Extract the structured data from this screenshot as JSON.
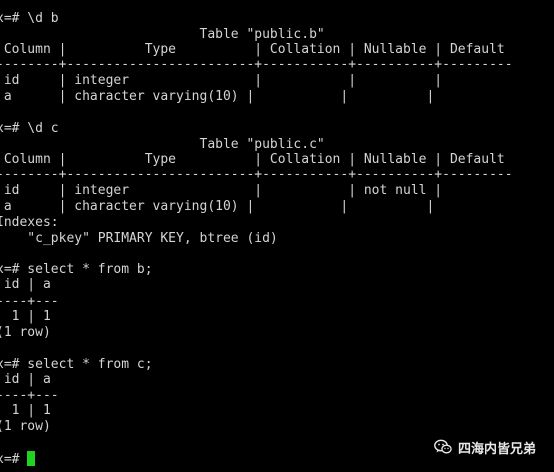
{
  "terminal": {
    "lines": [
      "x=# \\d b",
      "                          Table \"public.b\"",
      " Column |          Type          | Collation | Nullable | Default",
      "--------+------------------------+-----------+----------+---------",
      " id     | integer                |           |          |",
      " a      | character varying(10) |           |          |",
      "",
      "x=# \\d c",
      "                          Table \"public.c\"",
      " Column |          Type          | Collation | Nullable | Default",
      "--------+------------------------+-----------+----------+---------",
      " id     | integer                |           | not null |",
      " a      | character varying(10) |           |          |",
      "Indexes:",
      "    \"c_pkey\" PRIMARY KEY, btree (id)",
      "",
      "x=# select * from b;",
      " id | a",
      "----+---",
      "  1 | 1",
      "(1 row)",
      "",
      "x=# select * from c;",
      " id | a",
      "----+---",
      "  1 | 1",
      "(1 row)",
      "",
      "x=# "
    ],
    "cursor_color": "#21d321",
    "text_color": "#d4d4d4",
    "background": "#000000"
  },
  "watermark": {
    "icon": "wechat-icon",
    "text": "四海内皆兄弟"
  }
}
